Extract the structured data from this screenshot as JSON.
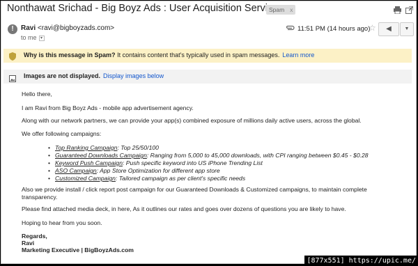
{
  "subject": {
    "title": "Nonthawat Srichad - Big Boyz Ads : User Acquisition Services",
    "label": "Spam",
    "label_close": "x"
  },
  "header": {
    "sender_name": "Ravi",
    "sender_email": "<ravi@bigboyzads.com>",
    "to": "to me",
    "time": "11:51 PM (14 hours ago)",
    "alert_glyph": "!"
  },
  "spam_banner": {
    "question": "Why is this message in Spam?",
    "explanation": "It contains content that's typically used in spam messages.",
    "link": "Learn more"
  },
  "images_bar": {
    "notice": "Images are not displayed.",
    "link": "Display images below"
  },
  "body": {
    "greeting": "Hello there,",
    "intro": "I am Ravi from Big Boyz Ads - mobile app advertisement agency.",
    "network": "Along with our network partners, we can provide your app(s) combined exposure of millions daily active users, across the global.",
    "offer": "We offer following campaigns:",
    "campaigns": [
      {
        "name": "Top Ranking Campaign",
        "desc": ": Top 25/50/100"
      },
      {
        "name": "Guaranteed Downloads Campaign",
        "desc": ": Ranging from 5,000 to 45,000 downloads, with CPI ranging between $0.45 - $0.28"
      },
      {
        "name": "Keyword Push Campaign",
        "desc": ": Push specific keyword into US iPhone Trending List"
      },
      {
        "name": "ASO Campaign",
        "desc": ": App Store Optimization for different app store"
      },
      {
        "name": "Customized Campaign",
        "desc": ": Tailored campaign as per client's specific needs"
      }
    ],
    "also": "Also we provide install / click report post campaign for our Guaranteed Downloads & Customized campaigns, to maintain complete transparency.",
    "deck": "Please find attached media deck, in here, As it outlines our rates and goes over dozens of questions you are likely to have.",
    "hoping": "Hoping to hear from you soon.",
    "regards": "Regards,",
    "sig_name": "Ravi",
    "sig_title": "Marketing Executive | BigBoyzAds.com"
  },
  "watermark": "[877x551] https://upic.me/",
  "colors": {
    "spam_banner_bg": "#fcf1c6",
    "link": "#1155cc",
    "images_bar_bg": "#f2f2f2"
  },
  "icons": [
    "print-icon",
    "new-window-icon",
    "alert-icon",
    "paperclip-icon",
    "star-icon",
    "reply-icon",
    "more-icon",
    "shield-icon",
    "image-icon"
  ]
}
